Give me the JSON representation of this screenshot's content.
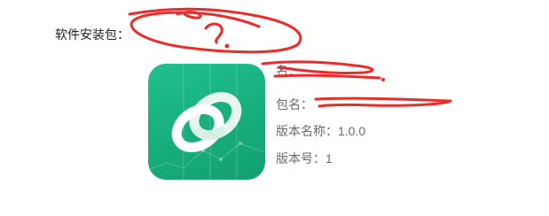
{
  "package_section": {
    "label": "软件安装包：",
    "app_icon": "green-app-icon-interlocking-rings",
    "details": {
      "name_label": "名：",
      "package_label": "包名：",
      "version_name_label": "版本名称：",
      "version_name_value": "1.0.0",
      "version_code_label": "版本号：",
      "version_code_value": "1"
    }
  },
  "annotations": {
    "scribble_color": "#ee2b2b",
    "question_mark": "?"
  },
  "colors": {
    "icon_green": "#1bb585",
    "text_gray": "#6a6a6a"
  }
}
